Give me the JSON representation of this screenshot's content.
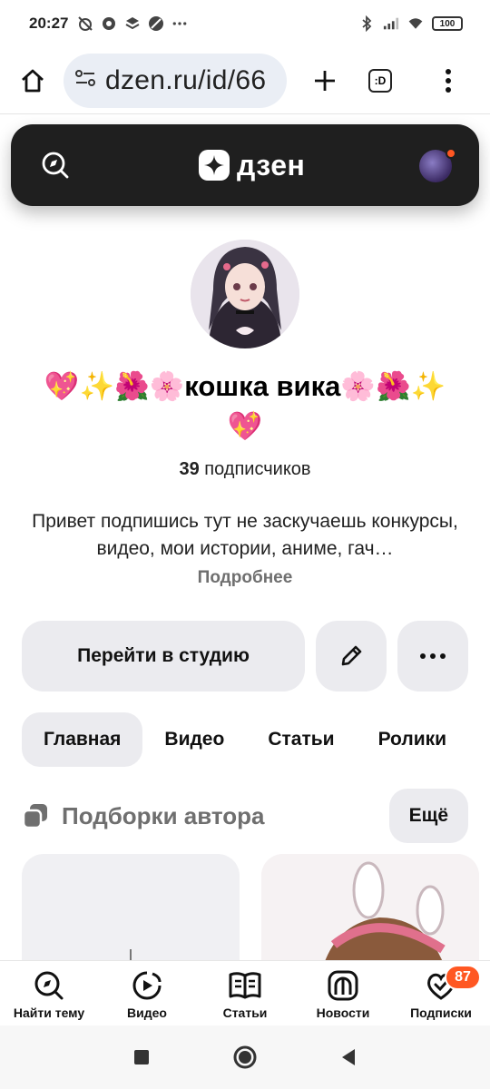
{
  "status_bar": {
    "time": "20:27",
    "battery": "100"
  },
  "browser": {
    "url": "dzen.ru/id/66",
    "tab_count": ":D"
  },
  "dzen": {
    "logo_text": "дзен"
  },
  "profile": {
    "name": "💖✨🌺🌸кошка вика🌸🌺✨💖",
    "subscribers_count": "39",
    "subscribers_label": "подписчиков",
    "bio": "Привет подпишись тут не заскучаешь конкурсы, видео, мои истории, аниме, гач…",
    "more_link": "Подробнее"
  },
  "actions": {
    "studio_label": "Перейти в студию"
  },
  "tabs": [
    {
      "label": "Главная",
      "active": true
    },
    {
      "label": "Видео",
      "active": false
    },
    {
      "label": "Статьи",
      "active": false
    },
    {
      "label": "Ролики",
      "active": false
    }
  ],
  "collections": {
    "title": "Подборки автора",
    "more_label": "Ещё"
  },
  "bottom_nav": [
    {
      "label": "Найти тему",
      "icon": "compass-search-icon"
    },
    {
      "label": "Видео",
      "icon": "video-play-icon"
    },
    {
      "label": "Статьи",
      "icon": "book-icon"
    },
    {
      "label": "Новости",
      "icon": "news-icon"
    },
    {
      "label": "Подписки",
      "icon": "subscriptions-icon",
      "badge": "87"
    }
  ],
  "colors": {
    "accent": "#ff5722",
    "header_bg": "#1f1f1f",
    "button_bg": "#ebebef",
    "muted_text": "#6f6f6f"
  }
}
